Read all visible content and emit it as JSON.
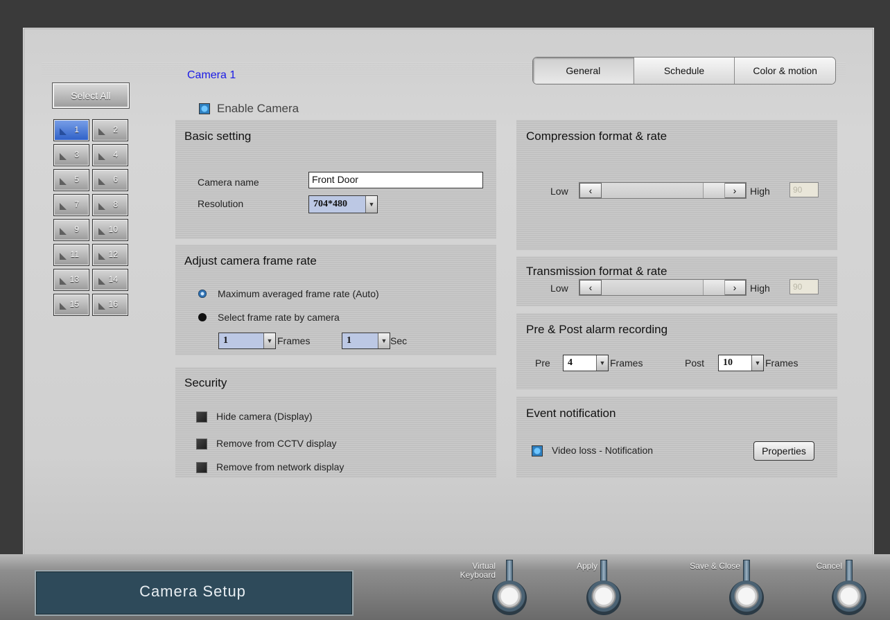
{
  "camera_title": "Camera 1",
  "tabs": [
    {
      "label": "General",
      "active": true
    },
    {
      "label": "Schedule",
      "active": false
    },
    {
      "label": "Color & motion",
      "active": false
    }
  ],
  "select_all_label": "Select All",
  "cameras": [
    "1",
    "2",
    "3",
    "4",
    "5",
    "6",
    "7",
    "8",
    "9",
    "10",
    "11",
    "12",
    "13",
    "14",
    "15",
    "16"
  ],
  "selected_camera": "1",
  "enable_camera_label": "Enable Camera",
  "basic": {
    "title": "Basic setting",
    "camera_name_label": "Camera name",
    "camera_name_value": "Front Door",
    "resolution_label": "Resolution",
    "resolution_value": "704*480"
  },
  "frame_rate": {
    "title": "Adjust camera frame rate",
    "option_auto": "Maximum averaged frame rate (Auto)",
    "option_select": "Select frame rate by camera",
    "frames_value": "1",
    "frames_label": "Frames",
    "sec_value": "1",
    "sec_label": "Sec"
  },
  "security": {
    "title": "Security",
    "hide_camera": "Hide camera (Display)",
    "remove_cctv": "Remove from CCTV display",
    "remove_network": "Remove from network display"
  },
  "compression": {
    "title": "Compression format & rate",
    "low": "Low",
    "high": "High",
    "value": "90"
  },
  "transmission": {
    "title": "Transmission format & rate",
    "low": "Low",
    "high": "High",
    "value": "90"
  },
  "alarm": {
    "title": "Pre & Post alarm recording",
    "pre_label": "Pre",
    "pre_value": "4",
    "pre_frames": "Frames",
    "post_label": "Post",
    "post_value": "10",
    "post_frames": "Frames"
  },
  "event": {
    "title": "Event notification",
    "video_loss": "Video loss - Notification",
    "properties_label": "Properties"
  },
  "footer": {
    "title": "Camera Setup",
    "virtual_keyboard_1": "Virtual",
    "virtual_keyboard_2": "Keyboard",
    "apply": "Apply",
    "save_close": "Save & Close",
    "cancel": "Cancel"
  },
  "colors": {
    "camera_title": "#1a1ae6",
    "selected_camera": "#2d5fc7",
    "footer_title_bg": "#2e4a5a"
  }
}
